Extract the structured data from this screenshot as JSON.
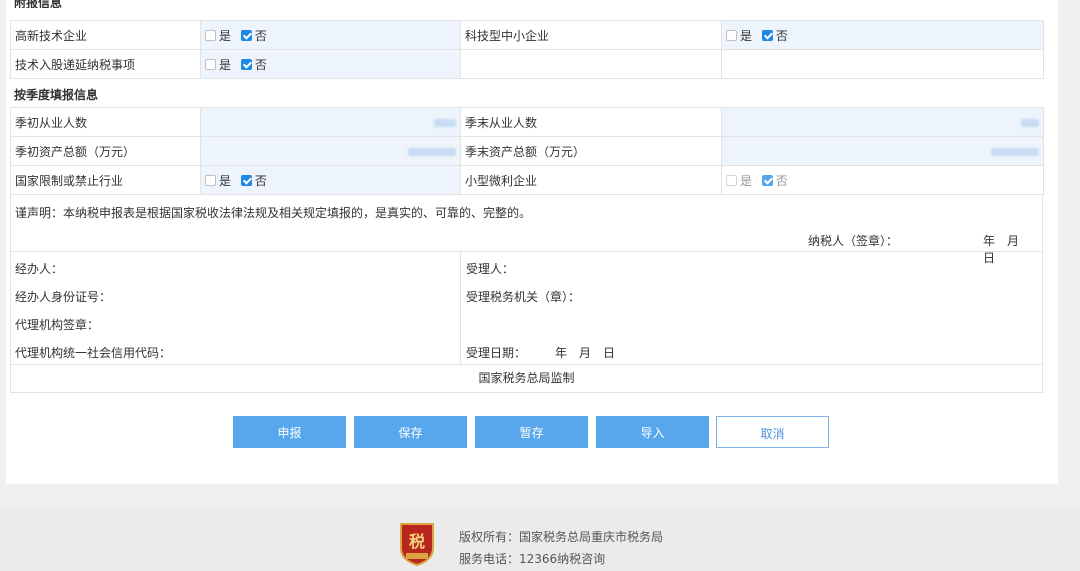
{
  "attached_section_title": "附报信息",
  "quarterly_section_title": "按季度填报信息",
  "options": {
    "yes": "是",
    "no": "否"
  },
  "rows": {
    "high_tech": {
      "label": "高新技术企业",
      "yes_checked": false,
      "no_checked": true
    },
    "tech_sme": {
      "label": "科技型中小企业",
      "yes_checked": false,
      "no_checked": true
    },
    "tech_share": {
      "label": "技术入股递延纳税事项",
      "yes_checked": false,
      "no_checked": true
    },
    "emp_start": {
      "label": "季初从业人数"
    },
    "emp_end": {
      "label": "季末从业人数"
    },
    "asset_start": {
      "label": "季初资产总额（万元）"
    },
    "asset_end": {
      "label": "季末资产总额（万元）"
    },
    "restricted": {
      "label": "国家限制或禁止行业",
      "yes_checked": false,
      "no_checked": true
    },
    "small_micro": {
      "label": "小型微利企业",
      "yes_checked": false,
      "no_checked": true,
      "disabled": true
    }
  },
  "declaration": {
    "text": "谨声明：本纳税申报表是根据国家税收法律法规及相关规定填报的，是真实的、可靠的、完整的。",
    "taxpayer_sign": "纳税人（签章）：",
    "date": "年　月　日"
  },
  "signature": {
    "handler": "经办人：",
    "handler_id": "经办人身份证号：",
    "agency_seal": "代理机构签章：",
    "agency_code": "代理机构统一社会信用代码：",
    "receiver": "受理人：",
    "tax_office": "受理税务机关（章）：",
    "receive_date_label": "受理日期：",
    "receive_date": "年　月　日"
  },
  "supervision": "国家税务总局监制",
  "buttons": {
    "submit": "申报",
    "save": "保存",
    "temp_save": "暂存",
    "import": "导入",
    "cancel": "取消"
  },
  "footer": {
    "copyright": "版权所有：国家税务总局重庆市税务局",
    "phone": "服务电话：12366纳税咨询",
    "logo_text": "税"
  },
  "colors": {
    "accent": "#58a7ec",
    "check": "#1e88e5",
    "cell_fill": "#eef4fc",
    "logo_red": "#b9261d"
  }
}
